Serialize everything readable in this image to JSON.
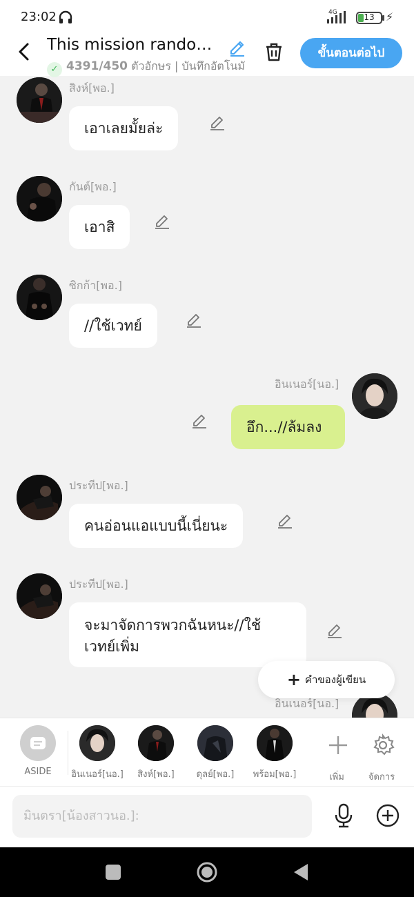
{
  "status_bar": {
    "time": "23:02",
    "battery_level": "13",
    "network": "4G"
  },
  "header": {
    "title": "This mission randomly...",
    "count": "4391/450",
    "meta": "ตัวอักษร | บันทึกอัตโนมั",
    "next_label": "ขั้นตอนต่อไป"
  },
  "messages": [
    {
      "name": "สิงห์[พอ.]",
      "text": "เอาเลยมั้ยล่ะ",
      "side": "left"
    },
    {
      "name": "กันต์[พอ.]",
      "text": "เอาสิ",
      "side": "left"
    },
    {
      "name": "ซิกก้า[พอ.]",
      "text": "//ใช้เวทย์",
      "side": "left"
    },
    {
      "name": "อินเนอร์[นอ.]",
      "text": "อึก...//ล้มลง",
      "side": "right"
    },
    {
      "name": "ประทีป[พอ.]",
      "text": "คนอ่อนแอแบบนี้เนี่ยนะ",
      "side": "left"
    },
    {
      "name": "ประทีป[พอ.]",
      "text": "จะมาจัดการพวกฉันหนะ//ใช้เวทย์เพิ่ม",
      "side": "left"
    },
    {
      "name": "อินเนอร์[นอ.]",
      "text": "",
      "side": "right"
    }
  ],
  "add_comment_label": "คำของผู้เขียน",
  "characters": [
    {
      "name": "ASIDE"
    },
    {
      "name": "อินเนอร์[นอ.]"
    },
    {
      "name": "สิงห์[พอ.]"
    },
    {
      "name": "ดุลย์[พอ.]"
    },
    {
      "name": "พร้อม[พอ.]"
    }
  ],
  "char_actions": {
    "add_label": "เพิ่ม",
    "manage_label": "จัดการ"
  },
  "input": {
    "placeholder": "มินตรา[น้องสาวนอ.]:"
  },
  "colors": {
    "accent": "#49a6f2",
    "mine_bubble": "#d9f08f",
    "check": "#3cb654"
  }
}
